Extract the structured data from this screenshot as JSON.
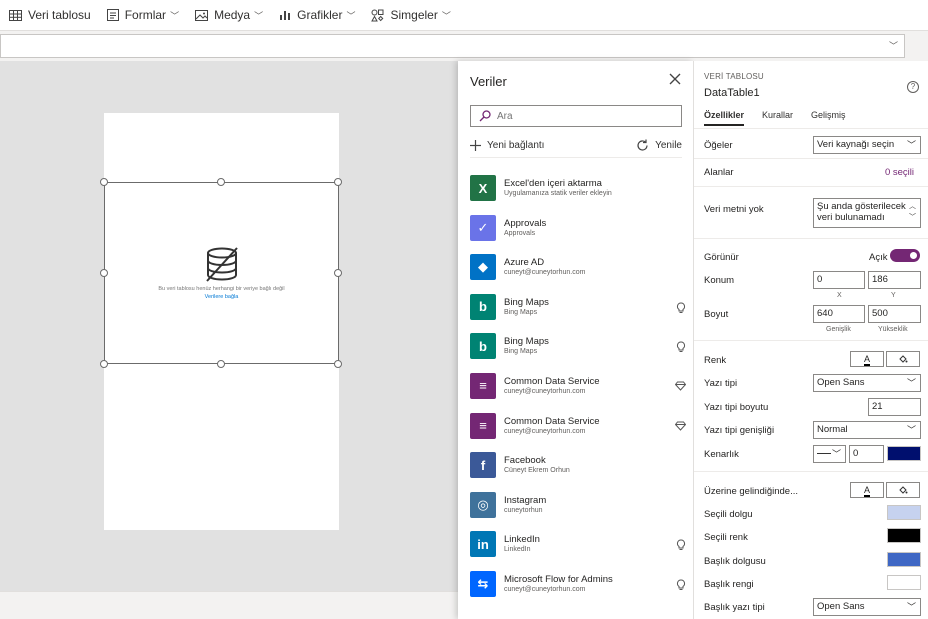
{
  "toolbar": {
    "items": [
      {
        "label": "Veri tablosu",
        "icon": "table-icon"
      },
      {
        "label": "Formlar",
        "icon": "form-icon"
      },
      {
        "label": "Medya",
        "icon": "image-icon"
      },
      {
        "label": "Grafikler",
        "icon": "chart-icon"
      },
      {
        "label": "Simgeler",
        "icon": "shapes-icon"
      }
    ]
  },
  "canvas": {
    "empty_message": "Bu veri tablosu henüz herhangi bir veriye bağlı değil",
    "connect_link": "Verilere bağla"
  },
  "data_pane": {
    "title": "Veriler",
    "search_placeholder": "Ara",
    "new_connection": "Yeni bağlantı",
    "refresh": "Yenile",
    "connections": [
      {
        "name": "Excel'den içeri aktarma",
        "sub": "Uygulamanıza statik veriler ekleyin",
        "color": "#217346",
        "glyph": "X",
        "badge": ""
      },
      {
        "name": "Approvals",
        "sub": "Approvals",
        "color": "#6a73e8",
        "glyph": "✓",
        "badge": ""
      },
      {
        "name": "Azure AD",
        "sub": "cuneyt@cuneytorhun.com",
        "color": "#0072c6",
        "glyph": "◆",
        "badge": ""
      },
      {
        "name": "Bing Maps",
        "sub": "Bing Maps",
        "color": "#008373",
        "glyph": "b",
        "badge": "bulb"
      },
      {
        "name": "Bing Maps",
        "sub": "Bing Maps",
        "color": "#008373",
        "glyph": "b",
        "badge": "bulb"
      },
      {
        "name": "Common Data Service",
        "sub": "cuneyt@cuneytorhun.com",
        "color": "#742774",
        "glyph": "≡",
        "badge": "diamond"
      },
      {
        "name": "Common Data Service",
        "sub": "cuneyt@cuneytorhun.com",
        "color": "#742774",
        "glyph": "≡",
        "badge": "diamond"
      },
      {
        "name": "Facebook",
        "sub": "Cüneyt Ekrem Orhun",
        "color": "#3b5998",
        "glyph": "f",
        "badge": ""
      },
      {
        "name": "Instagram",
        "sub": "cuneytorhun",
        "color": "#3f729b",
        "glyph": "◎",
        "badge": ""
      },
      {
        "name": "LinkedIn",
        "sub": "LinkedIn",
        "color": "#0077b5",
        "glyph": "in",
        "badge": "bulb"
      },
      {
        "name": "Microsoft Flow for Admins",
        "sub": "cuneyt@cuneytorhun.com",
        "color": "#0066ff",
        "glyph": "⇆",
        "badge": "bulb"
      }
    ]
  },
  "props": {
    "type": "VERİ TABLOSU",
    "name": "DataTable1",
    "tabs": [
      "Özellikler",
      "Kurallar",
      "Gelişmiş"
    ],
    "items_label": "Öğeler",
    "items_value": "Veri kaynağı seçin",
    "fields_label": "Alanlar",
    "fields_value": "0 seçili",
    "no_data_label": "Veri metni yok",
    "no_data_value": "Şu anda gösterilecek veri bulunamadı",
    "visible_label": "Görünür",
    "visible_value": "Açık",
    "position_label": "Konum",
    "pos_x": "0",
    "pos_y": "186",
    "x_caption": "X",
    "y_caption": "Y",
    "size_label": "Boyut",
    "width": "640",
    "height": "500",
    "width_caption": "Genişlik",
    "height_caption": "Yükseklik",
    "color_label": "Renk",
    "font_label": "Yazı tipi",
    "font_value": "Open Sans",
    "font_size_label": "Yazı tipi boyutu",
    "font_size_value": "21",
    "font_weight_label": "Yazı tipi genişliği",
    "font_weight_value": "Normal",
    "border_label": "Kenarlık",
    "border_width": "0",
    "hover_label": "Üzerine gelindiğinde...",
    "sel_fill_label": "Seçili dolgu",
    "sel_color_label": "Seçili renk",
    "header_fill_label": "Başlık dolgusu",
    "header_color_label": "Başlık rengi",
    "header_font_label": "Başlık yazı tipi",
    "header_font_value": "Open Sans",
    "text_button_glyph": "A",
    "colors": {
      "accent": "#742774",
      "border_color": "#000f6e",
      "selected_fill": "#c6d2ef",
      "selected_color": "#000000",
      "header_fill": "#3f67c4",
      "header_color": "#ffffff"
    }
  }
}
